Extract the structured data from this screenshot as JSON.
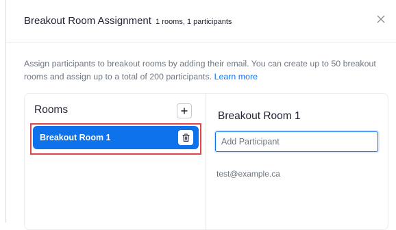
{
  "dialog": {
    "title": "Breakout Room Assignment",
    "subtitle": "1 rooms, 1 participants",
    "close_icon": "close-icon",
    "description": "Assign participants to breakout rooms by adding their email. You can create up to 50 breakout rooms and assign up to a total of 200 participants.",
    "learn_more": "Learn more"
  },
  "rooms_panel": {
    "label": "Rooms",
    "add_icon": "plus-icon",
    "items": [
      {
        "label": "Breakout Room 1",
        "selected": true,
        "delete_icon": "trash-icon"
      }
    ]
  },
  "room_detail": {
    "title": "Breakout Room 1",
    "input_placeholder": "Add Participant",
    "input_value": "",
    "participants": [
      "test@example.ca"
    ]
  },
  "colors": {
    "accent": "#0e72ed",
    "highlight_outline": "#e0444a",
    "muted_text": "#6e7680"
  }
}
